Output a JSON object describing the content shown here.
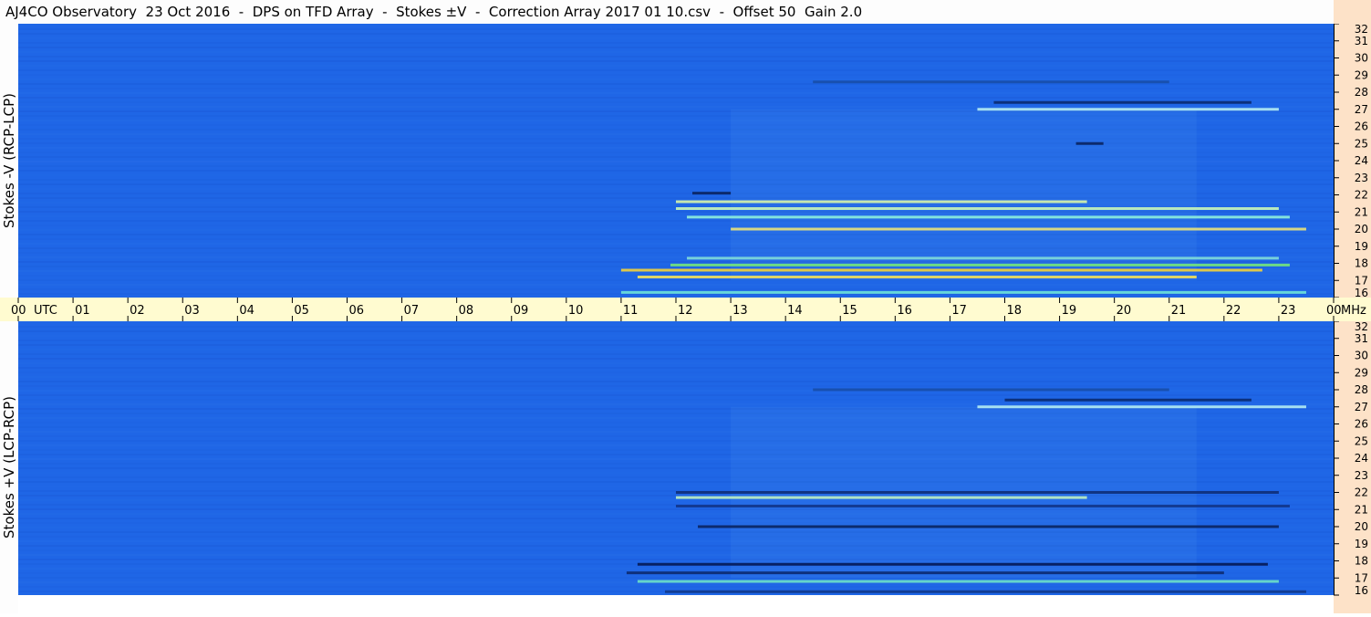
{
  "title": "AJ4CO Observatory  23 Oct 2016  -  DPS on TFD Array  -  Stokes ±V  -  Correction Array 2017 01 10.csv  -  Offset 50  Gain 2.0",
  "chart_data": [
    {
      "type": "heatmap",
      "name": "top-panel",
      "ylabel": "Stokes -V (RCP-LCP)",
      "x_unit": "UTC",
      "x_ticks": [
        "00",
        "01",
        "02",
        "03",
        "04",
        "05",
        "06",
        "07",
        "08",
        "09",
        "10",
        "11",
        "12",
        "13",
        "14",
        "15",
        "16",
        "17",
        "18",
        "19",
        "20",
        "21",
        "22",
        "23",
        "00"
      ],
      "xlim": [
        0,
        24
      ],
      "y_unit": "MHz",
      "y_ticks": [
        16,
        17,
        18,
        19,
        20,
        21,
        22,
        23,
        24,
        25,
        26,
        27,
        28,
        29,
        30,
        31,
        32
      ],
      "ylim": [
        16,
        32
      ],
      "background_color": "#1f66e6",
      "features": [
        {
          "freq": 17.6,
          "t_start": 11.0,
          "t_end": 22.7,
          "color": "#f3d23a"
        },
        {
          "freq": 17.2,
          "t_start": 11.3,
          "t_end": 21.5,
          "color": "#f2e05a"
        },
        {
          "freq": 17.9,
          "t_start": 11.9,
          "t_end": 23.2,
          "color": "#76e57a"
        },
        {
          "freq": 16.3,
          "t_start": 11.0,
          "t_end": 23.5,
          "color": "#6ee2d8"
        },
        {
          "freq": 18.3,
          "t_start": 12.2,
          "t_end": 23.0,
          "color": "#7fdcd9"
        },
        {
          "freq": 20.0,
          "t_start": 13.0,
          "t_end": 23.5,
          "color": "#eae27a"
        },
        {
          "freq": 20.7,
          "t_start": 12.2,
          "t_end": 23.2,
          "color": "#8ef0dc"
        },
        {
          "freq": 21.2,
          "t_start": 12.0,
          "t_end": 23.0,
          "color": "#c9f6b8"
        },
        {
          "freq": 21.6,
          "t_start": 12.0,
          "t_end": 19.5,
          "color": "#d8f5a8"
        },
        {
          "freq": 22.1,
          "t_start": 12.3,
          "t_end": 13.0,
          "color": "#0a2460"
        },
        {
          "freq": 25.0,
          "t_start": 19.3,
          "t_end": 19.8,
          "color": "#0a2460"
        },
        {
          "freq": 27.0,
          "t_start": 17.5,
          "t_end": 23.0,
          "color": "#b5ecf2"
        },
        {
          "freq": 27.4,
          "t_start": 17.8,
          "t_end": 22.5,
          "color": "#0a2a70"
        },
        {
          "freq": 28.6,
          "t_start": 14.5,
          "t_end": 21.0,
          "color": "#174ea8"
        }
      ]
    },
    {
      "type": "heatmap",
      "name": "bottom-panel",
      "ylabel": "Stokes +V (LCP-RCP)",
      "x_unit": "UTC",
      "x_ticks": [
        "00",
        "01",
        "02",
        "03",
        "04",
        "05",
        "06",
        "07",
        "08",
        "09",
        "10",
        "11",
        "12",
        "13",
        "14",
        "15",
        "16",
        "17",
        "18",
        "19",
        "20",
        "21",
        "22",
        "23",
        "00"
      ],
      "xlim": [
        0,
        24
      ],
      "y_unit": "MHz",
      "y_ticks": [
        16,
        17,
        18,
        19,
        20,
        21,
        22,
        23,
        24,
        25,
        26,
        27,
        28,
        29,
        30,
        31,
        32
      ],
      "ylim": [
        16,
        32
      ],
      "background_color": "#1f66e6",
      "features": [
        {
          "freq": 17.8,
          "t_start": 11.3,
          "t_end": 22.8,
          "color": "#061a55"
        },
        {
          "freq": 17.3,
          "t_start": 11.1,
          "t_end": 22.0,
          "color": "#0c2a70"
        },
        {
          "freq": 16.8,
          "t_start": 11.3,
          "t_end": 23.0,
          "color": "#6de0c8"
        },
        {
          "freq": 16.2,
          "t_start": 11.8,
          "t_end": 23.5,
          "color": "#123a8c"
        },
        {
          "freq": 20.0,
          "t_start": 12.4,
          "t_end": 23.0,
          "color": "#0a2460"
        },
        {
          "freq": 21.2,
          "t_start": 12.0,
          "t_end": 23.2,
          "color": "#12358a"
        },
        {
          "freq": 21.7,
          "t_start": 12.0,
          "t_end": 19.5,
          "color": "#bff0c0"
        },
        {
          "freq": 22.0,
          "t_start": 12.0,
          "t_end": 23.0,
          "color": "#0e2d78"
        },
        {
          "freq": 27.0,
          "t_start": 17.5,
          "t_end": 23.5,
          "color": "#b5ecf2"
        },
        {
          "freq": 27.4,
          "t_start": 18.0,
          "t_end": 22.5,
          "color": "#0a2a70"
        },
        {
          "freq": 28.0,
          "t_start": 14.5,
          "t_end": 21.0,
          "color": "#174ea8"
        }
      ]
    }
  ]
}
